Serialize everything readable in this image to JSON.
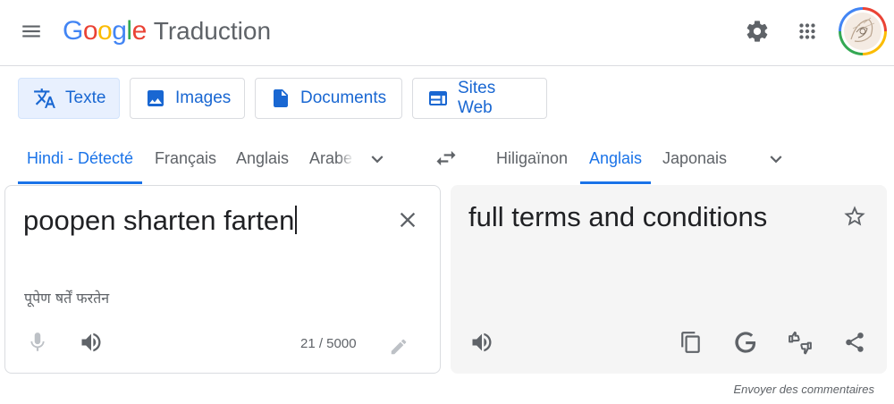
{
  "header": {
    "logo_letters": [
      {
        "ch": "G",
        "color": "#4285f4"
      },
      {
        "ch": "o",
        "color": "#ea4335"
      },
      {
        "ch": "o",
        "color": "#fbbc04"
      },
      {
        "ch": "g",
        "color": "#4285f4"
      },
      {
        "ch": "l",
        "color": "#34a853"
      },
      {
        "ch": "e",
        "color": "#ea4335"
      }
    ],
    "product_name": "Traduction",
    "icons": [
      "menu-icon",
      "gear-icon",
      "apps-grid-icon",
      "avatar"
    ]
  },
  "modes": [
    {
      "label": "Texte",
      "icon": "translate-icon",
      "active": true
    },
    {
      "label": "Images",
      "icon": "image-icon",
      "active": false
    },
    {
      "label": "Documents",
      "icon": "document-icon",
      "active": false
    },
    {
      "label": "Sites Web",
      "icon": "website-icon",
      "active": false
    }
  ],
  "source_langs": [
    {
      "label": "Hindi - Détecté",
      "active": true
    },
    {
      "label": "Français",
      "active": false
    },
    {
      "label": "Anglais",
      "active": false
    },
    {
      "label": "Arabe",
      "active": false
    }
  ],
  "target_langs": [
    {
      "label": "Hiligaïnon",
      "active": false
    },
    {
      "label": "Anglais",
      "active": true
    },
    {
      "label": "Japonais",
      "active": false
    }
  ],
  "source": {
    "text": "poopen sharten farten",
    "transliteration": "पूपेण षर्तें फरतेन",
    "char_count": "21 / 5000"
  },
  "target": {
    "text": "full terms and conditions"
  },
  "footer": {
    "feedback": "Envoyer des commentaires"
  },
  "colors": {
    "accent": "#1a73e8",
    "icon_gray": "#5f6368",
    "target_bg": "#f5f5f5"
  }
}
